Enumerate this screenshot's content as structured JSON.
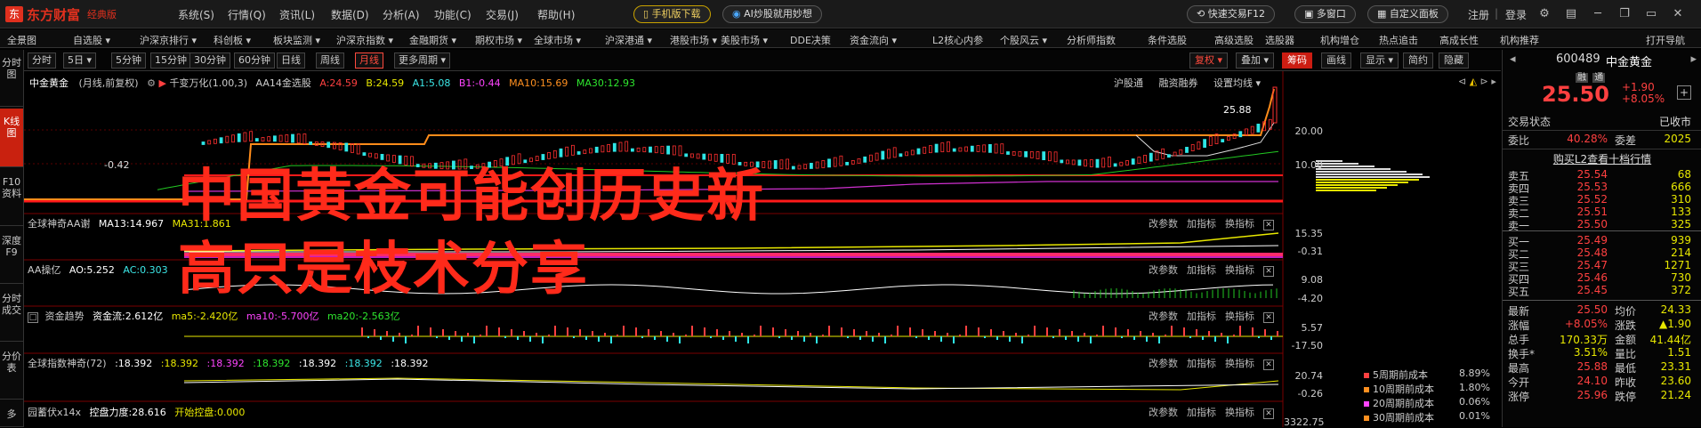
{
  "app": {
    "logo_text": "东方财富",
    "edition": "经典版"
  },
  "menu": [
    "系统(S)",
    "行情(Q)",
    "资讯(L)",
    "数据(D)",
    "分析(A)",
    "功能(C)",
    "交易(J)",
    "帮助(H)"
  ],
  "top_buttons": {
    "mobile_download": "手机版下载",
    "ai": "AI炒股就用妙想",
    "quick_trade": "快速交易F12",
    "multi_window": "多窗口",
    "custom_panel": "自定义面板",
    "register": "注册",
    "login": "登录"
  },
  "navbar": [
    "全景图",
    "自选股 ▾",
    "沪深京排行 ▾",
    "科创板 ▾",
    "板块监测 ▾",
    "沪深京指数 ▾",
    "金融期货 ▾",
    "期权市场 ▾",
    "全球市场 ▾",
    "沪深港通 ▾",
    "港股市场 ▾",
    "美股市场 ▾",
    "DDE决策",
    "资金流向 ▾",
    "L2核心内参",
    "个股风云 ▾",
    "分析师指数",
    "条件选股",
    "高级选股",
    "选股器",
    "机构增仓",
    "热点追击",
    "高成长性",
    "机构推荐",
    "打开导航"
  ],
  "periods": [
    "分时",
    "5日 ▾",
    "5分钟",
    "15分钟",
    "30分钟",
    "60分钟",
    "日线",
    "周线",
    "月线",
    "更多周期 ▾"
  ],
  "active_period": "月线",
  "right_tools": [
    "复权 ▾",
    "叠加 ▾",
    "筹码",
    "画线",
    "显示 ▾",
    "简约",
    "隐藏"
  ],
  "left_tabs": [
    "分时图",
    "K线图",
    "F10资料",
    "深度F9",
    "分时成交",
    "分价表",
    "多"
  ],
  "main_panel": {
    "stock_name": "中金黄金",
    "mode": "(月线,前复权)",
    "indicator": "千变万化(1.00,3)",
    "aa14": "AA14金选股",
    "values": [
      "A:24.59",
      "B:24.59",
      "A1:5.08",
      "B1:-0.44",
      "MA10:15.69",
      "MA30:12.93"
    ],
    "top_links": [
      "沪股通",
      "融资融券",
      "设置均线 ▾"
    ],
    "max_label": "25.88",
    "min_label": "-0.42",
    "axis": [
      "20.00",
      "10.00"
    ]
  },
  "sub_panels": [
    {
      "title": "全球神奇AA谢",
      "values": [
        "MA13:14.967",
        "MA31:1.861"
      ],
      "axis": [
        "15.35",
        "-0.31"
      ]
    },
    {
      "title": "AA操亿",
      "values": [
        "AO:5.252",
        "AC:0.303"
      ],
      "axis": [
        "9.08",
        "-4.20"
      ]
    },
    {
      "title": "资金趋势",
      "values": [
        "资金流:2.612亿",
        "ma5:-2.420亿",
        "ma10:-5.700亿",
        "ma20:-2.563亿"
      ],
      "axis": [
        "5.57",
        "-17.50"
      ]
    },
    {
      "title": "全球指数神奇(72)",
      "values": [
        ":18.392",
        ":18.392",
        ":18.392",
        ":18.392",
        ":18.392",
        ":18.392",
        ":18.392"
      ],
      "axis": [
        "20.74",
        "-0.26"
      ]
    },
    {
      "title": "园蓄伏x14x",
      "values": [
        "控盘力度:28.616",
        "开始控盘:0.000"
      ],
      "axis": [
        "3322.75"
      ]
    }
  ],
  "panel_buttons": [
    "改参数",
    "加指标",
    "换指标"
  ],
  "overlay_text": "中国黄金可能创历史新高只是枝术分享",
  "cost_legend": [
    {
      "label": "5周期前成本",
      "value": "8.89%",
      "color": "#ff4040"
    },
    {
      "label": "10周期前成本",
      "value": "1.80%",
      "color": "#ff9020"
    },
    {
      "label": "20周期前成本",
      "value": "0.06%",
      "color": "#ff44ff"
    },
    {
      "label": "30周期前成本",
      "value": "0.01%",
      "color": "#ff9020"
    }
  ],
  "quote": {
    "code": "600489",
    "name": "中金黄金",
    "tags": [
      "融",
      "通"
    ],
    "price": "25.50",
    "change": "+1.90",
    "pct": "+8.05%",
    "trade_status_label": "交易状态",
    "trade_status": "已收市",
    "wb_label": "委比",
    "wb": "40.28%",
    "wc_label": "委差",
    "wc": "2025",
    "l2_link": "购买L2查看十档行情",
    "asks": [
      {
        "l": "卖五",
        "p": "25.54",
        "v": "68"
      },
      {
        "l": "卖四",
        "p": "25.53",
        "v": "666"
      },
      {
        "l": "卖三",
        "p": "25.52",
        "v": "310"
      },
      {
        "l": "卖二",
        "p": "25.51",
        "v": "133"
      },
      {
        "l": "卖一",
        "p": "25.50",
        "v": "325"
      }
    ],
    "bids": [
      {
        "l": "买一",
        "p": "25.49",
        "v": "939"
      },
      {
        "l": "买二",
        "p": "25.48",
        "v": "214"
      },
      {
        "l": "买三",
        "p": "25.47",
        "v": "1271"
      },
      {
        "l": "买四",
        "p": "25.46",
        "v": "730"
      },
      {
        "l": "买五",
        "p": "25.45",
        "v": "372"
      }
    ],
    "stats": [
      {
        "l": "最新",
        "v": "25.50",
        "vc": "red",
        "l2": "均价",
        "v2": "24.33",
        "v2c": "red"
      },
      {
        "l": "涨幅",
        "v": "+8.05%",
        "vc": "red",
        "l2": "涨跌",
        "v2": "▲1.90",
        "v2c": "red"
      },
      {
        "l": "总手",
        "v": "170.33万",
        "vc": "yel",
        "l2": "金额",
        "v2": "41.44亿",
        "v2c": "cyan"
      },
      {
        "l": "换手*",
        "v": "3.51%",
        "vc": "yel",
        "l2": "量比",
        "v2": "1.51",
        "v2c": "red"
      },
      {
        "l": "最高",
        "v": "25.88",
        "vc": "red",
        "l2": "最低",
        "v2": "23.31",
        "v2c": "green"
      },
      {
        "l": "今开",
        "v": "24.10",
        "vc": "red",
        "l2": "昨收",
        "v2": "23.60",
        "v2c": "white"
      },
      {
        "l": "涨停",
        "v": "25.96",
        "vc": "red",
        "l2": "跌停",
        "v2": "21.24",
        "v2c": "green"
      }
    ]
  }
}
